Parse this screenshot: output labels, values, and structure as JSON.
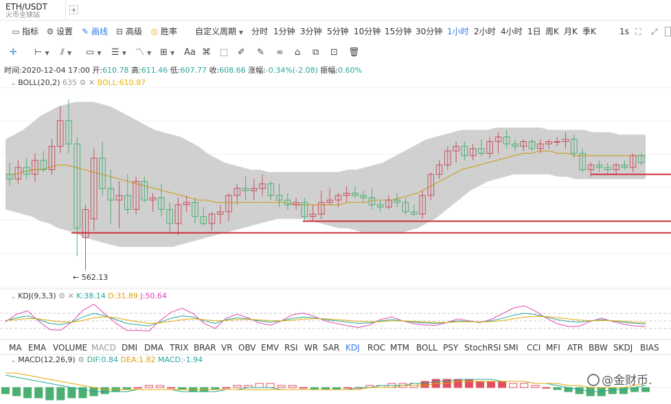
{
  "tab": {
    "title": "ETH/USDT",
    "subtitle": "火币全球站",
    "add_icon": "plus-icon"
  },
  "toolbar": {
    "items": [
      {
        "label": "指标",
        "icon": "chart-line-icon"
      },
      {
        "label": "设置",
        "icon": "gear-icon"
      },
      {
        "label": "画线",
        "icon": "pen-icon",
        "active": true
      },
      {
        "label": "高级",
        "icon": "briefcase-icon"
      },
      {
        "label": "胜率",
        "icon": "target-icon"
      }
    ],
    "custom_period": "自定义周期",
    "periods": [
      "分时",
      "1分钟",
      "3分钟",
      "5分钟",
      "10分钟",
      "15分钟",
      "30分钟",
      "1小时",
      "2小时",
      "4小时",
      "1日",
      "周K",
      "月K",
      "季K"
    ],
    "active_period": "1小时",
    "refresh": "1s"
  },
  "draw_tools": [
    "crosshair-icon",
    "horizontal-line-icon",
    "parallel-lines-icon",
    "rectangle-icon",
    "fib-icon",
    "wave-icon",
    "measure-icon",
    "text-icon",
    "magnet-icon",
    "ruler-icon",
    "pencil-icon",
    "lock-icon",
    "eye-icon",
    "clone-icon",
    "hide-icon",
    "trash-icon"
  ],
  "info": {
    "time_label": "时间:",
    "time": "2020-12-04 17:00",
    "open_label": "开:",
    "open": "610.78",
    "high_label": "高:",
    "high": "611.46",
    "low_label": "低:",
    "low": "607.77",
    "close_label": "收:",
    "close": "608.66",
    "change_label": "涨幅:",
    "change": "-0.34%(-2.08)",
    "amp_label": "振幅:",
    "amp": "0.60%"
  },
  "boll": {
    "name": "BOLL(20,2)",
    "hidden_value": "635",
    "value": "BOLL:610.87"
  },
  "price_markers": {
    "low": "562.13"
  },
  "kdj": {
    "name": "KDJ(9,3,3)",
    "k": "K:38.14",
    "d": "D:31.89",
    "j": "J:50.64"
  },
  "indicators": [
    "MA",
    "EMA",
    "VOLUME",
    "MACD",
    "DMI",
    "DMA",
    "TRIX",
    "BRAR",
    "VR",
    "OBV",
    "EMV",
    "RSI",
    "WR",
    "SAR",
    "KDJ",
    "ROC",
    "MTM",
    "BOLL",
    "PSY",
    "StochRSI",
    "SMI",
    "CCI",
    "MFI",
    "ATR",
    "BBW",
    "SKDJ",
    "BIAS"
  ],
  "active_indicator": "KDJ",
  "macd": {
    "name": "MACD(12,26,9)",
    "dif": "DIF:0.84",
    "dea": "DEA:1.82",
    "macd": "MACD:-1.94"
  },
  "watermark": "@金财币.",
  "colors": {
    "up": "#c8505e",
    "down": "#4caf72",
    "band": "#c8c8c8",
    "mid": "#c9a227",
    "support": "#d0303c",
    "accent": "#2d7be5"
  },
  "chart_data": {
    "type": "candlestick",
    "symbol": "ETH/USDT",
    "interval": "1小时",
    "ylim": [
      555,
      640
    ],
    "candles": [
      {
        "o": 603,
        "h": 608,
        "l": 598,
        "c": 601
      },
      {
        "o": 601,
        "h": 609,
        "l": 599,
        "c": 606
      },
      {
        "o": 606,
        "h": 610,
        "l": 601,
        "c": 603
      },
      {
        "o": 603,
        "h": 612,
        "l": 600,
        "c": 609
      },
      {
        "o": 609,
        "h": 613,
        "l": 604,
        "c": 605
      },
      {
        "o": 605,
        "h": 618,
        "l": 603,
        "c": 615
      },
      {
        "o": 615,
        "h": 632,
        "l": 612,
        "c": 626
      },
      {
        "o": 626,
        "h": 635,
        "l": 612,
        "c": 616
      },
      {
        "o": 616,
        "h": 619,
        "l": 568,
        "c": 580
      },
      {
        "o": 576,
        "h": 590,
        "l": 562,
        "c": 588
      },
      {
        "o": 584,
        "h": 614,
        "l": 579,
        "c": 610
      },
      {
        "o": 610,
        "h": 617,
        "l": 594,
        "c": 597
      },
      {
        "o": 597,
        "h": 605,
        "l": 582,
        "c": 592
      },
      {
        "o": 592,
        "h": 600,
        "l": 580,
        "c": 594
      },
      {
        "o": 594,
        "h": 603,
        "l": 586,
        "c": 588
      },
      {
        "o": 588,
        "h": 602,
        "l": 586,
        "c": 600
      },
      {
        "o": 600,
        "h": 602,
        "l": 591,
        "c": 592
      },
      {
        "o": 592,
        "h": 595,
        "l": 587,
        "c": 593
      },
      {
        "o": 593,
        "h": 599,
        "l": 585,
        "c": 588
      },
      {
        "o": 588,
        "h": 591,
        "l": 578,
        "c": 582
      },
      {
        "o": 582,
        "h": 593,
        "l": 577,
        "c": 590
      },
      {
        "o": 590,
        "h": 594,
        "l": 587,
        "c": 591
      },
      {
        "o": 591,
        "h": 593,
        "l": 582,
        "c": 585
      },
      {
        "o": 585,
        "h": 589,
        "l": 581,
        "c": 582
      },
      {
        "o": 582,
        "h": 587,
        "l": 579,
        "c": 586
      },
      {
        "o": 586,
        "h": 590,
        "l": 582,
        "c": 587
      },
      {
        "o": 587,
        "h": 595,
        "l": 583,
        "c": 594
      },
      {
        "o": 594,
        "h": 599,
        "l": 590,
        "c": 597
      },
      {
        "o": 597,
        "h": 602,
        "l": 592,
        "c": 596
      },
      {
        "o": 596,
        "h": 601,
        "l": 592,
        "c": 597
      },
      {
        "o": 597,
        "h": 603,
        "l": 594,
        "c": 599
      },
      {
        "o": 599,
        "h": 600,
        "l": 592,
        "c": 594
      },
      {
        "o": 594,
        "h": 599,
        "l": 589,
        "c": 592
      },
      {
        "o": 592,
        "h": 595,
        "l": 588,
        "c": 590
      },
      {
        "o": 590,
        "h": 593,
        "l": 588,
        "c": 591
      },
      {
        "o": 591,
        "h": 593,
        "l": 583,
        "c": 585
      },
      {
        "o": 585,
        "h": 590,
        "l": 583,
        "c": 586
      },
      {
        "o": 586,
        "h": 596,
        "l": 584,
        "c": 591
      },
      {
        "o": 591,
        "h": 597,
        "l": 590,
        "c": 592
      },
      {
        "o": 592,
        "h": 595,
        "l": 589,
        "c": 594
      },
      {
        "o": 594,
        "h": 598,
        "l": 591,
        "c": 595
      },
      {
        "o": 595,
        "h": 598,
        "l": 593,
        "c": 594
      },
      {
        "o": 594,
        "h": 596,
        "l": 591,
        "c": 593
      },
      {
        "o": 593,
        "h": 597,
        "l": 588,
        "c": 590
      },
      {
        "o": 590,
        "h": 592,
        "l": 587,
        "c": 589
      },
      {
        "o": 589,
        "h": 594,
        "l": 588,
        "c": 592
      },
      {
        "o": 592,
        "h": 595,
        "l": 589,
        "c": 591
      },
      {
        "o": 591,
        "h": 593,
        "l": 586,
        "c": 587
      },
      {
        "o": 587,
        "h": 590,
        "l": 585,
        "c": 586
      },
      {
        "o": 586,
        "h": 596,
        "l": 584,
        "c": 594
      },
      {
        "o": 594,
        "h": 604,
        "l": 592,
        "c": 603
      },
      {
        "o": 603,
        "h": 609,
        "l": 601,
        "c": 607
      },
      {
        "o": 607,
        "h": 615,
        "l": 605,
        "c": 613
      },
      {
        "o": 613,
        "h": 617,
        "l": 608,
        "c": 615
      },
      {
        "o": 615,
        "h": 617,
        "l": 609,
        "c": 611
      },
      {
        "o": 611,
        "h": 616,
        "l": 609,
        "c": 614
      },
      {
        "o": 614,
        "h": 618,
        "l": 611,
        "c": 612
      },
      {
        "o": 612,
        "h": 619,
        "l": 610,
        "c": 617
      },
      {
        "o": 617,
        "h": 621,
        "l": 612,
        "c": 619
      },
      {
        "o": 619,
        "h": 622,
        "l": 614,
        "c": 616
      },
      {
        "o": 616,
        "h": 618,
        "l": 613,
        "c": 615
      },
      {
        "o": 615,
        "h": 618,
        "l": 613,
        "c": 617
      },
      {
        "o": 617,
        "h": 618,
        "l": 613,
        "c": 614
      },
      {
        "o": 614,
        "h": 618,
        "l": 612,
        "c": 616
      },
      {
        "o": 616,
        "h": 618,
        "l": 614,
        "c": 617
      },
      {
        "o": 617,
        "h": 619,
        "l": 615,
        "c": 617
      },
      {
        "o": 617,
        "h": 621,
        "l": 614,
        "c": 618
      },
      {
        "o": 618,
        "h": 620,
        "l": 610,
        "c": 612
      },
      {
        "o": 612,
        "h": 614,
        "l": 604,
        "c": 605
      },
      {
        "o": 605,
        "h": 608,
        "l": 602,
        "c": 607
      },
      {
        "o": 607,
        "h": 609,
        "l": 604,
        "c": 606
      },
      {
        "o": 606,
        "h": 608,
        "l": 603,
        "c": 605
      },
      {
        "o": 605,
        "h": 608,
        "l": 603,
        "c": 607
      },
      {
        "o": 607,
        "h": 609,
        "l": 605,
        "c": 606
      },
      {
        "o": 606,
        "h": 612,
        "l": 604,
        "c": 611
      },
      {
        "o": 611,
        "h": 612,
        "l": 607,
        "c": 608
      }
    ],
    "boll": {
      "upper": [
        618,
        620,
        622,
        625,
        628,
        630,
        632,
        633,
        634,
        634,
        634,
        633,
        632,
        630,
        628,
        626,
        624,
        622,
        621,
        620,
        619,
        617,
        615,
        612,
        610,
        608,
        607,
        606,
        605,
        605,
        604,
        604,
        604,
        604,
        604,
        604,
        604,
        604,
        604,
        605,
        605,
        606,
        607,
        608,
        610,
        612,
        614,
        616,
        618,
        619,
        620,
        621,
        622,
        622,
        622,
        622,
        623,
        623,
        623,
        623,
        623,
        623,
        622,
        622,
        622,
        622,
        622,
        621,
        621,
        621,
        620,
        620,
        620,
        620
      ],
      "mid": [
        603,
        603,
        604,
        605,
        605,
        606,
        607,
        607,
        606,
        605,
        604,
        603,
        602,
        601,
        600,
        599,
        598,
        597,
        596,
        595,
        594,
        593,
        592,
        592,
        591,
        591,
        591,
        591,
        591,
        591,
        591,
        591,
        591,
        590,
        590,
        590,
        590,
        590,
        590,
        591,
        591,
        591,
        592,
        592,
        592,
        593,
        594,
        595,
        597,
        599,
        601,
        603,
        605,
        606,
        607,
        608,
        609,
        610,
        611,
        612,
        612,
        613,
        613,
        612,
        612,
        611,
        611,
        611,
        611,
        611,
        611,
        611,
        611,
        611
      ],
      "lower": [
        588,
        587,
        586,
        585,
        583,
        582,
        580,
        579,
        578,
        576,
        575,
        574,
        573,
        572,
        572,
        572,
        572,
        572,
        572,
        572,
        573,
        574,
        575,
        576,
        577,
        578,
        579,
        580,
        581,
        582,
        583,
        584,
        584,
        584,
        584,
        583,
        582,
        581,
        580,
        580,
        579,
        578,
        578,
        578,
        578,
        578,
        579,
        580,
        582,
        584,
        587,
        590,
        593,
        596,
        598,
        600,
        601,
        602,
        603,
        603,
        603,
        603,
        603,
        602,
        602,
        601,
        601,
        601,
        601,
        601,
        601,
        601,
        601,
        601
      ]
    },
    "support_lines": [
      578,
      583,
      603
    ],
    "kdj": {
      "k": [
        50,
        62,
        70,
        55,
        40,
        35,
        45,
        65,
        80,
        70,
        55,
        40,
        35,
        30,
        45,
        60,
        70,
        65,
        50,
        40,
        55,
        62,
        58,
        50,
        45,
        50,
        60,
        65,
        62,
        55,
        50,
        45,
        40,
        42,
        50,
        55,
        50,
        45,
        42,
        40,
        44,
        50,
        48,
        45,
        50,
        60,
        72,
        80,
        75,
        65,
        55,
        48,
        45,
        50,
        55,
        50,
        45,
        40,
        38
      ],
      "d": [
        52,
        55,
        60,
        58,
        52,
        46,
        45,
        52,
        62,
        66,
        62,
        54,
        46,
        40,
        42,
        48,
        55,
        58,
        55,
        50,
        52,
        55,
        56,
        54,
        51,
        50,
        53,
        57,
        59,
        58,
        55,
        52,
        48,
        46,
        47,
        50,
        50,
        48,
        46,
        44,
        44,
        46,
        47,
        46,
        47,
        51,
        58,
        65,
        68,
        67,
        63,
        58,
        53,
        51,
        52,
        51,
        49,
        45,
        43
      ],
      "j": [
        46,
        76,
        90,
        49,
        16,
        13,
        45,
        91,
        116,
        78,
        41,
        12,
        13,
        10,
        51,
        84,
        100,
        79,
        40,
        20,
        61,
        76,
        62,
        42,
        33,
        50,
        74,
        81,
        68,
        49,
        40,
        31,
        24,
        34,
        56,
        65,
        50,
        39,
        34,
        32,
        44,
        58,
        50,
        43,
        56,
        78,
        100,
        110,
        89,
        61,
        39,
        28,
        29,
        48,
        61,
        48,
        37,
        30,
        28
      ]
    },
    "macd": {
      "hist": [
        -3,
        -4,
        -5,
        -5,
        -6,
        -6,
        -5,
        -5,
        -4,
        -3,
        -2,
        -1,
        0,
        1,
        1,
        0,
        -1,
        -2,
        -2,
        -1,
        0,
        1,
        1,
        2,
        2,
        1,
        1,
        0,
        -1,
        -1,
        -1,
        0,
        0,
        1,
        1,
        2,
        2,
        2,
        3,
        4,
        4,
        4,
        4,
        3,
        3,
        3,
        2,
        2,
        1,
        0,
        -1,
        -2,
        -3,
        -4,
        -4,
        -3,
        -3,
        -2,
        -2
      ],
      "dif": [
        6,
        5,
        4,
        3,
        2,
        1,
        0,
        -1,
        -2,
        -2,
        -2,
        -2,
        -1,
        -1,
        -1,
        -1,
        -2,
        -2,
        -2,
        -2,
        -1,
        -1,
        0,
        0,
        0,
        -1,
        -1,
        -1,
        -1,
        -1,
        -1,
        -1,
        0,
        0,
        1,
        1,
        1,
        2,
        2,
        3,
        3,
        4,
        4,
        4,
        4,
        3,
        3,
        3,
        2,
        2,
        1,
        0,
        -1,
        -2,
        -2,
        -1,
        -1,
        0,
        1
      ],
      "dea": [
        7,
        7,
        6,
        5,
        4,
        3,
        2,
        1,
        0,
        -1,
        -1,
        -1,
        -1,
        -1,
        -1,
        -1,
        -1,
        -1,
        -1,
        -1,
        -1,
        -1,
        -1,
        -1,
        -1,
        -1,
        -1,
        -1,
        -1,
        -1,
        -1,
        -1,
        -1,
        0,
        0,
        0,
        1,
        1,
        1,
        2,
        2,
        3,
        3,
        3,
        3,
        3,
        3,
        3,
        2,
        2,
        2,
        1,
        1,
        0,
        0,
        0,
        0,
        1,
        2
      ]
    }
  }
}
